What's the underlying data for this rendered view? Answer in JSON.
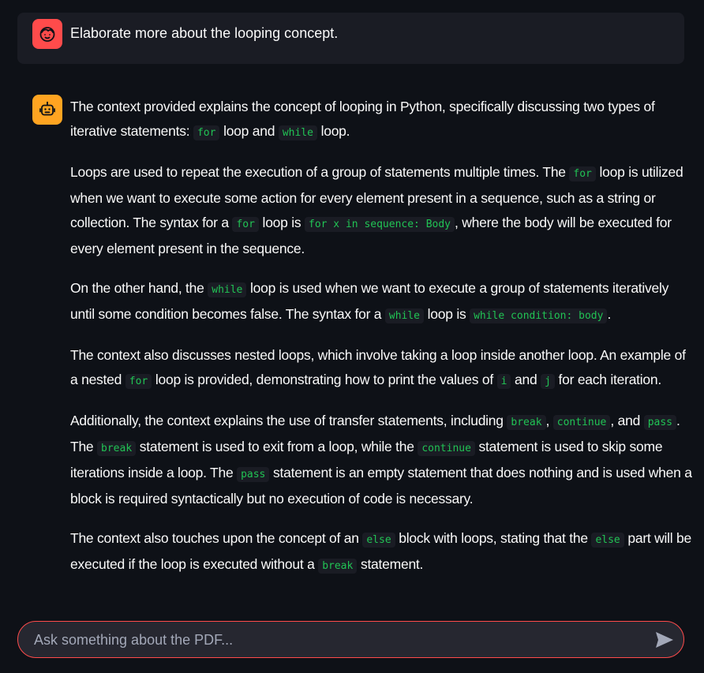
{
  "user_message": {
    "avatar_icon": "user-face-icon",
    "text": "Elaborate more about the looping concept."
  },
  "assistant_message": {
    "avatar_icon": "bot-icon",
    "p1": {
      "t1": "The context provided explains the concept of looping in Python, specifically discussing two types of iterative statements: ",
      "c1": "for",
      "t2": " loop and ",
      "c2": "while",
      "t3": " loop."
    },
    "p2": {
      "t1": "Loops are used to repeat the execution of a group of statements multiple times. The ",
      "c1": "for",
      "t2": " loop is utilized when we want to execute some action for every element present in a sequence, such as a string or collection. The syntax for a ",
      "c2": "for",
      "t3": " loop is ",
      "c3": "for x in sequence: Body",
      "t4": ", where the body will be executed for every element present in the sequence."
    },
    "p3": {
      "t1": "On the other hand, the ",
      "c1": "while",
      "t2": " loop is used when we want to execute a group of statements iteratively until some condition becomes false. The syntax for a ",
      "c2": "while",
      "t3": " loop is ",
      "c3": "while condition: body",
      "t4": "."
    },
    "p4": {
      "t1": "The context also discusses nested loops, which involve taking a loop inside another loop. An example of a nested ",
      "c1": "for",
      "t2": " loop is provided, demonstrating how to print the values of ",
      "c2": "i",
      "t3": " and ",
      "c3": "j",
      "t4": " for each iteration."
    },
    "p5": {
      "t1": "Additionally, the context explains the use of transfer statements, including ",
      "c1": "break",
      "t2": ", ",
      "c2": "continue",
      "t3": ", and ",
      "c3": "pass",
      "t4": ". The ",
      "c4": "break",
      "t5": " statement is used to exit from a loop, while the ",
      "c5": "continue",
      "t6": " statement is used to skip some iterations inside a loop. The ",
      "c6": "pass",
      "t7": " statement is an empty statement that does nothing and is used when a block is required syntactically but no execution of code is necessary."
    },
    "p6": {
      "t1": "The context also touches upon the concept of an ",
      "c1": "else",
      "t2": " block with loops, stating that the ",
      "c2": "else",
      "t3": " part will be executed if the loop is executed without a ",
      "c3": "break",
      "t4": " statement."
    }
  },
  "chat_input": {
    "placeholder": "Ask something about the PDF...",
    "value": "",
    "send_icon": "send-icon"
  },
  "colors": {
    "background": "#0e1117",
    "user_message_bg": "#1a1c24",
    "user_avatar": "#ff4b4b",
    "bot_avatar": "#ffa421",
    "code_text": "#21c354",
    "input_border": "#ff4b4b"
  }
}
